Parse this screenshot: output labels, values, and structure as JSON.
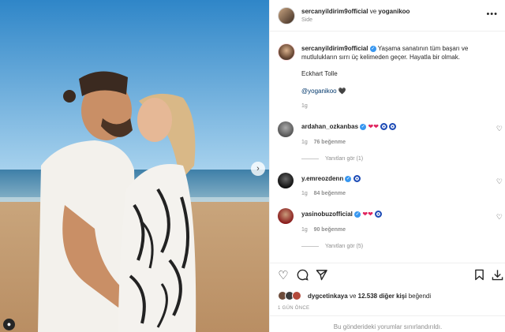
{
  "header": {
    "username": "sercanyildirim9official",
    "connector": "ve",
    "collaborator": "yoganikoo",
    "location": "Side"
  },
  "caption": {
    "username": "sercanyildirim9official",
    "text": "Yaşama sanatının tüm başarı ve mutlulukların sırrı üç kelimeden geçer. Hayatla bir olmak.",
    "author": "Eckhart Tolle",
    "mention": "@yoganikoo",
    "heart": "🖤",
    "time": "1g"
  },
  "comments": [
    {
      "username": "ardahan_ozkanbas",
      "time": "1g",
      "likes": "76 beğenme",
      "replies": "Yanıtları gör (1)"
    },
    {
      "username": "y.emreozdenn",
      "time": "1g",
      "likes": "84 beğenme",
      "replies": ""
    },
    {
      "username": "yasinobuzofficial",
      "time": "1g",
      "likes": "90 beğenme",
      "replies": "Yanıtları gör (5)"
    }
  ],
  "likes": {
    "first_user": "dygcetinkaya",
    "connector": "ve",
    "others": "12.538 diğer kişi",
    "suffix": "beğendi"
  },
  "post_date": "1 GÜN ÖNCE",
  "comments_limited": "Bu gönderideki yorumlar sınırlandırıldı.",
  "icons": {
    "more": "more-horizontal-icon",
    "like": "heart-icon",
    "comment": "comment-icon",
    "share": "paper-plane-icon",
    "save": "bookmark-icon",
    "download": "download-icon",
    "next": "chevron-right-icon"
  },
  "colors": {
    "verified": "#3897f0",
    "link": "#00376b",
    "muted": "#8e8e8e",
    "heart_red": "#e0245e"
  }
}
